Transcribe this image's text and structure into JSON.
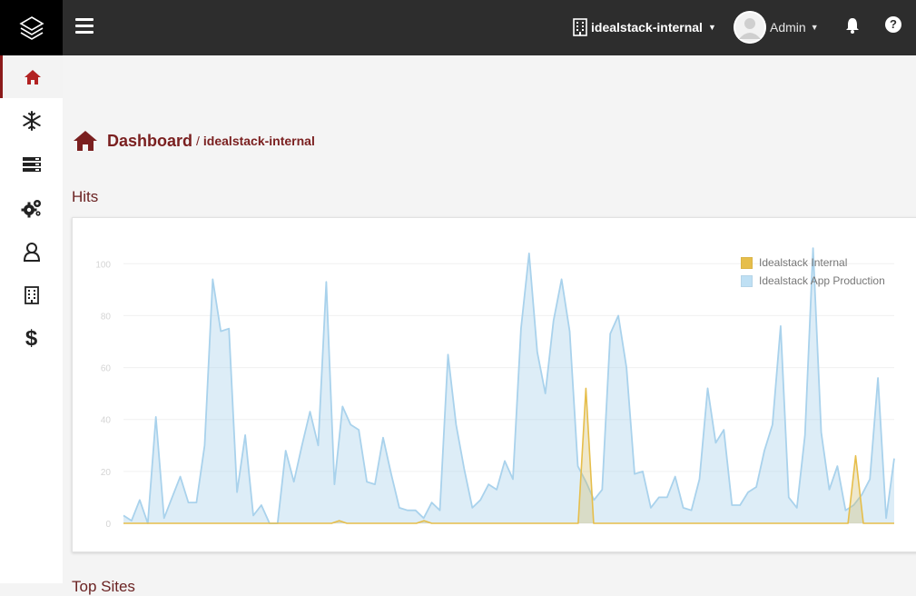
{
  "header": {
    "org_selector": {
      "label": "idealstack-internal"
    },
    "user_menu": {
      "label": "Admin"
    }
  },
  "sidebar": {
    "items": [
      {
        "name": "dashboard",
        "icon": "home-icon",
        "active": true
      },
      {
        "name": "snowflake",
        "icon": "snowflake-icon"
      },
      {
        "name": "servers",
        "icon": "server-stack-icon"
      },
      {
        "name": "settings",
        "icon": "cogs-icon"
      },
      {
        "name": "users",
        "icon": "user-icon"
      },
      {
        "name": "organizations",
        "icon": "building-icon"
      },
      {
        "name": "billing",
        "icon": "dollar-icon",
        "glyph": "$"
      }
    ]
  },
  "breadcrumb": {
    "title": "Dashboard",
    "separator": "/",
    "org": "idealstack-internal"
  },
  "sections": {
    "hits_title": "Hits",
    "next_title": "Top Sites"
  },
  "colors": {
    "accent": "#7a1f1f",
    "topbar": "#2d2d2d",
    "series_internal": "#e6be4b",
    "series_production": "#a9d2ec"
  },
  "chart_data": {
    "type": "area",
    "title": "",
    "xlabel": "",
    "ylabel": "",
    "ylim": [
      0,
      105
    ],
    "yticks": [
      0,
      20,
      40,
      60,
      80,
      100
    ],
    "grid": true,
    "legend_position": "top-right",
    "series": [
      {
        "name": "Idealstack Internal",
        "color": "#e6be4b",
        "values": [
          0,
          0,
          0,
          0,
          0,
          0,
          0,
          0,
          0,
          0,
          0,
          0,
          0,
          0,
          0,
          0,
          0,
          0,
          0,
          0,
          0,
          0,
          0,
          0,
          0,
          0,
          0,
          0,
          0,
          0,
          0,
          0,
          0,
          0,
          0,
          0,
          0,
          0,
          0,
          0,
          0,
          0,
          0,
          0,
          0,
          0,
          0,
          0,
          0,
          0,
          0,
          0,
          0,
          0,
          0,
          0,
          0,
          0,
          0,
          0,
          0,
          0,
          0,
          0,
          0,
          0,
          0,
          0,
          0,
          0,
          0,
          0,
          0,
          0,
          0,
          0,
          0,
          0,
          0,
          0,
          0,
          0,
          0,
          0,
          0,
          0,
          0,
          0,
          0,
          0,
          0,
          0,
          0,
          0,
          0,
          0,
          0,
          0,
          0,
          0,
          0
        ]
      },
      {
        "name": "Idealstack App Production",
        "color": "#a9d2ec",
        "values": [
          3,
          1,
          9,
          0,
          41,
          2,
          10,
          18,
          8,
          8,
          30,
          94,
          74,
          75,
          12,
          34,
          3,
          7,
          0,
          0,
          28,
          16,
          30,
          43,
          30,
          93,
          15,
          45,
          38,
          36,
          16,
          15,
          33,
          19,
          6,
          5,
          5,
          2,
          8,
          5,
          65,
          38,
          21,
          6,
          9,
          15,
          13,
          24,
          17,
          75,
          104,
          66,
          50,
          78,
          94,
          74,
          22,
          16,
          9,
          13,
          73,
          80,
          60,
          19,
          20,
          6,
          10,
          10,
          18,
          6,
          5,
          17,
          52,
          31,
          36,
          7,
          7,
          12,
          14,
          28,
          38,
          76,
          10,
          6,
          34,
          106,
          35,
          13,
          22,
          5,
          7,
          11,
          17,
          56,
          2,
          25
        ]
      }
    ],
    "internal_spikes": [
      [
        28,
        1
      ],
      [
        39,
        1
      ],
      [
        60,
        52
      ],
      [
        95,
        26
      ]
    ]
  }
}
